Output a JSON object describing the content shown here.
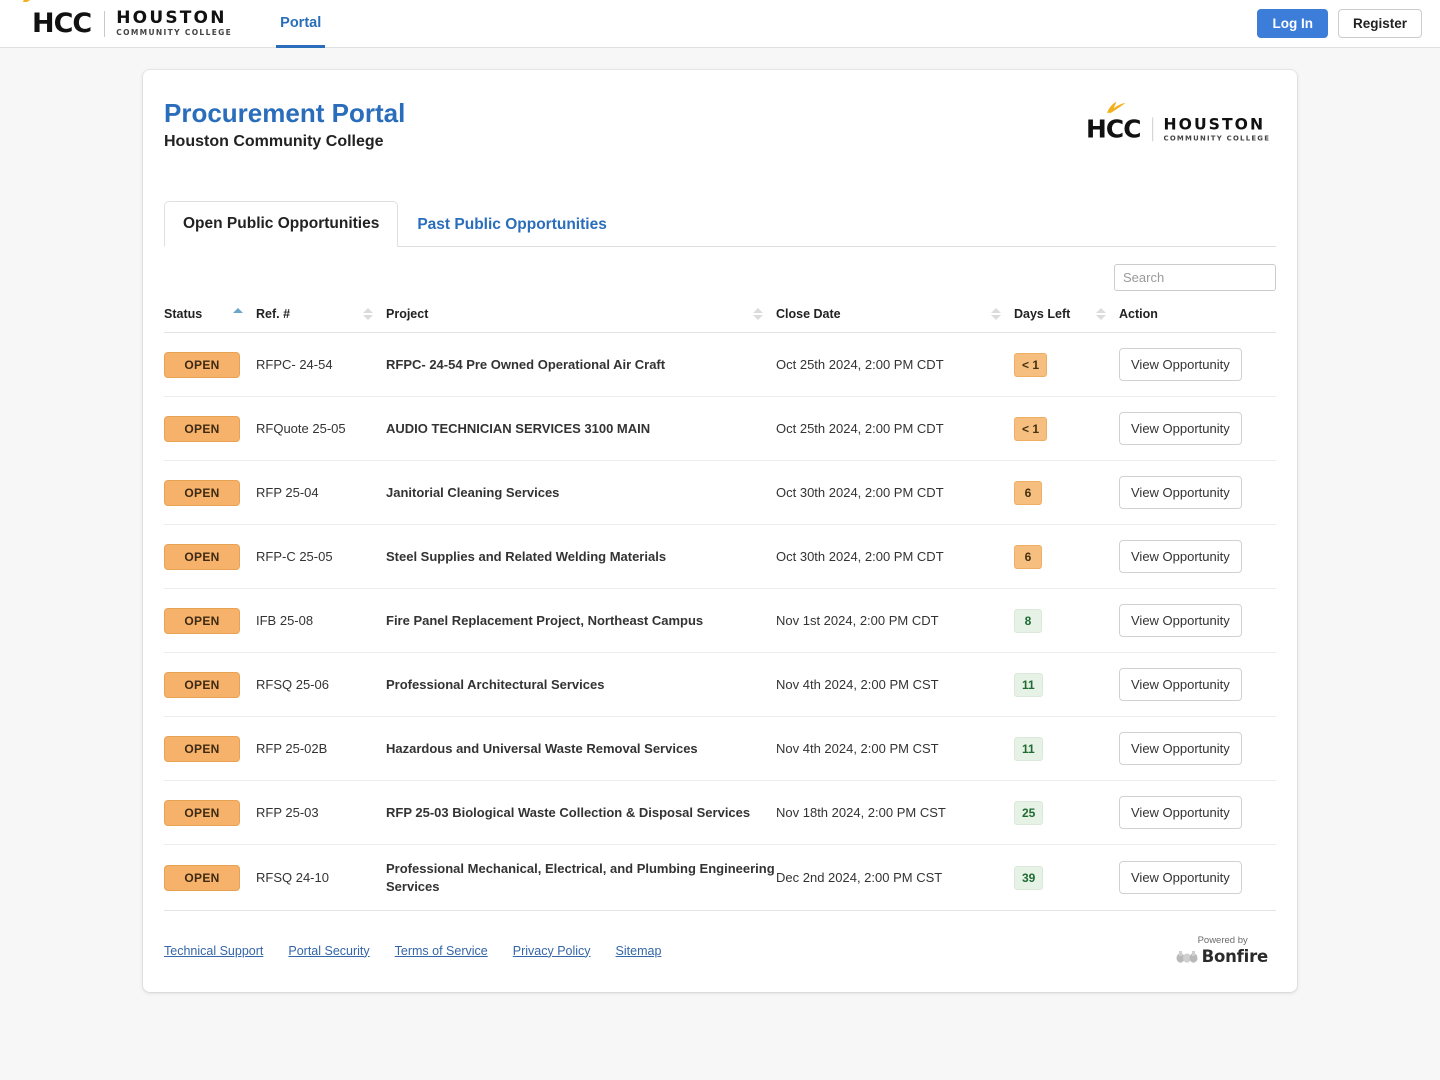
{
  "navbar": {
    "logo": {
      "mark": "HCC",
      "bird_icon": "bird-icon",
      "word_top": "HOUSTON",
      "word_bottom": "COMMUNITY COLLEGE"
    },
    "links": [
      {
        "label": "Portal",
        "active": true
      }
    ],
    "login_label": "Log In",
    "register_label": "Register"
  },
  "card": {
    "title": "Procurement Portal",
    "subtitle": "Houston Community College",
    "logo": {
      "mark": "HCC",
      "word_top": "HOUSTON",
      "word_bottom": "COMMUNITY COLLEGE"
    }
  },
  "tabs": [
    {
      "label": "Open Public Opportunities",
      "active": true
    },
    {
      "label": "Past Public Opportunities",
      "active": false
    }
  ],
  "search": {
    "placeholder": "Search",
    "value": ""
  },
  "table": {
    "columns": [
      {
        "label": "Status",
        "sort": "asc"
      },
      {
        "label": "Ref. #",
        "sort": "none"
      },
      {
        "label": "Project",
        "sort": "none"
      },
      {
        "label": "Close Date",
        "sort": "none"
      },
      {
        "label": "Days Left",
        "sort": "none"
      },
      {
        "label": "Action",
        "sort": null
      }
    ],
    "action_label": "View Opportunity",
    "rows": [
      {
        "status": "OPEN",
        "ref": "RFPC- 24-54",
        "project": "RFPC- 24-54 Pre Owned Operational Air Craft",
        "close_date": "Oct 25th 2024, 2:00 PM CDT",
        "days_left": "< 1",
        "days_level": "warn"
      },
      {
        "status": "OPEN",
        "ref": "RFQuote 25-05",
        "project": "AUDIO TECHNICIAN SERVICES 3100 MAIN",
        "close_date": "Oct 25th 2024, 2:00 PM CDT",
        "days_left": "< 1",
        "days_level": "warn"
      },
      {
        "status": "OPEN",
        "ref": "RFP 25-04",
        "project": "Janitorial Cleaning Services",
        "close_date": "Oct 30th 2024, 2:00 PM CDT",
        "days_left": "6",
        "days_level": "warn"
      },
      {
        "status": "OPEN",
        "ref": "RFP-C 25-05",
        "project": "Steel Supplies and Related Welding Materials",
        "close_date": "Oct 30th 2024, 2:00 PM CDT",
        "days_left": "6",
        "days_level": "warn"
      },
      {
        "status": "OPEN",
        "ref": "IFB 25-08",
        "project": "Fire Panel Replacement Project, Northeast Campus",
        "close_date": "Nov 1st 2024, 2:00 PM CDT",
        "days_left": "8",
        "days_level": "ok"
      },
      {
        "status": "OPEN",
        "ref": "RFSQ 25-06",
        "project": "Professional Architectural Services",
        "close_date": "Nov 4th 2024, 2:00 PM CST",
        "days_left": "11",
        "days_level": "ok"
      },
      {
        "status": "OPEN",
        "ref": "RFP 25-02B",
        "project": "Hazardous and Universal Waste Removal Services",
        "close_date": "Nov 4th 2024, 2:00 PM CST",
        "days_left": "11",
        "days_level": "ok"
      },
      {
        "status": "OPEN",
        "ref": "RFP 25-03",
        "project": "RFP 25-03 Biological Waste Collection & Disposal Services",
        "close_date": "Nov 18th 2024, 2:00 PM CST",
        "days_left": "25",
        "days_level": "ok"
      },
      {
        "status": "OPEN",
        "ref": "RFSQ 24-10",
        "project": "Professional Mechanical, Electrical, and Plumbing Engineering Services",
        "close_date": "Dec 2nd 2024, 2:00 PM CST",
        "days_left": "39",
        "days_level": "ok"
      }
    ]
  },
  "footer": {
    "links": [
      "Technical Support",
      "Portal Security",
      "Terms of Service",
      "Privacy Policy",
      "Sitemap"
    ],
    "powered_by_text": "Powered by",
    "powered_by_name": "Bonfire"
  },
  "colors": {
    "brand_blue": "#2a6ebb",
    "login_blue": "#3b7dd8",
    "badge_orange": "#f6b26b",
    "badge_green_bg": "#e6f2e6",
    "badge_green_text": "#1f6b32",
    "logo_accent": "#f2b01e",
    "page_bg": "#f7f7f7"
  }
}
